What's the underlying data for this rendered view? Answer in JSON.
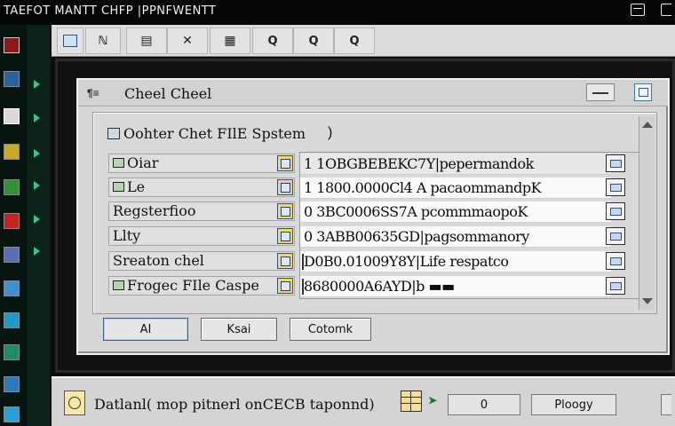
{
  "window": {
    "title": "TAEFOT MANTT CHFP |PPNFWENTT"
  },
  "toolbar": {
    "buttons": [
      {
        "label": "",
        "icon": "window-icon"
      },
      {
        "label": "ℕ",
        "icon": "n-icon"
      },
      {
        "label": "",
        "icon": "grid-icon"
      },
      {
        "label": "",
        "icon": "tool-icon"
      },
      {
        "label": "",
        "icon": "monitor-icon"
      },
      {
        "label": "Q",
        "icon": "search-icon"
      },
      {
        "label": "Q",
        "icon": "search-icon"
      },
      {
        "label": "Q",
        "icon": "search-icon"
      }
    ]
  },
  "dialog": {
    "title_icon": "¶≡",
    "title": "Cheel Cheel",
    "group": {
      "title": "Oohter Chet FIlE Spstem",
      "close_paren": ")"
    },
    "rows": [
      {
        "label": "Oiar",
        "value": "1 1OBGBEBEKC7Y|pepermandok",
        "highlighted": true
      },
      {
        "label": "Le",
        "value": "1 1800.0000Cl4 A pacaommandpK",
        "highlighted": false
      },
      {
        "label": "Regsterfioo",
        "value": "0 3BC0006SS7A pcommmaopoK",
        "highlighted": false
      },
      {
        "label": "Llty",
        "value": "0 3ABB00635GD|pagsommanory",
        "highlighted": false
      },
      {
        "label": "Sreaton chel",
        "value": "D0B0.01009Y8Y|Life respatco",
        "highlighted": false
      },
      {
        "label": "Frogec FIle Caspe",
        "value": "8680000A6AYD|b ▬▬",
        "highlighted": false
      }
    ],
    "buttons": {
      "primary": "AI",
      "second": "Ksai",
      "third": "Cotomk"
    }
  },
  "statusbar": {
    "text": "Datlanl( mop pitnerl onCECB taponnd)",
    "arrow": "➤",
    "button1": "0",
    "button2": "Ploogy",
    "button3": ""
  },
  "colors": {
    "window_bg": "#0e1012",
    "dialog_bg": "#d7d7d7",
    "accent_blue": "#2d5aa8",
    "dock_bg": "#07140f",
    "dock_arrow": "#3fc28a"
  }
}
